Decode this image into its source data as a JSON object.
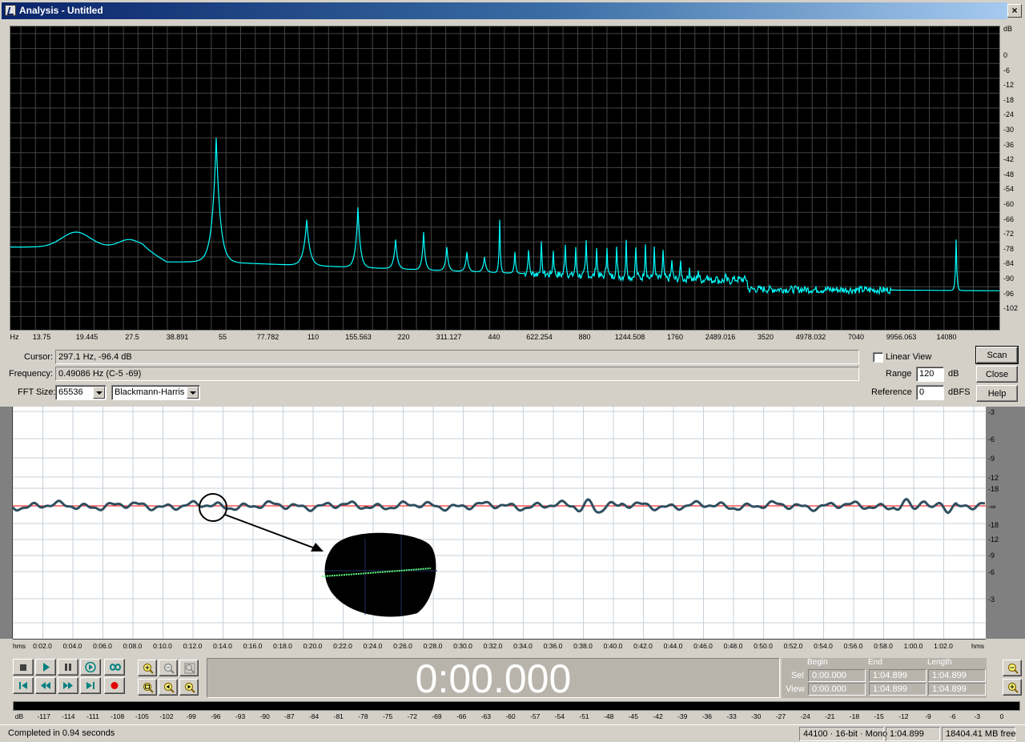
{
  "window": {
    "title": "Analysis - Untitled",
    "close_label": "×"
  },
  "spectrum": {
    "db_unit": "dB",
    "db_labels": [
      "0",
      "-6",
      "-12",
      "-18",
      "-24",
      "-30",
      "-36",
      "-42",
      "-48",
      "-54",
      "-60",
      "-66",
      "-72",
      "-78",
      "-84",
      "-90",
      "-96",
      "-102"
    ],
    "hz_unit": "Hz",
    "hz_labels": [
      "13.75",
      "19.445",
      "27.5",
      "38.891",
      "55",
      "77.782",
      "110",
      "155.563",
      "220",
      "311.127",
      "440",
      "622.254",
      "880",
      "1244.508",
      "1760",
      "2489.016",
      "3520",
      "4978.032",
      "7040",
      "9956.063",
      "14080"
    ],
    "trace_color": "#00ffff",
    "grid_color": "#444444"
  },
  "controls": {
    "cursor_label": "Cursor:",
    "cursor_value": "297.1 Hz,  -96.4 dB",
    "frequency_label": "Frequency:",
    "frequency_value": "0.49086 Hz (C-5 -69)",
    "fft_size_label": "FFT Size:",
    "fft_size_value": "65536",
    "window_value": "Blackmann-Harris",
    "linear_view_label": "Linear View",
    "range_label": "Range",
    "range_value": "120",
    "range_unit": "dB",
    "reference_label": "Reference",
    "reference_value": "0",
    "reference_unit": "dBFS",
    "scan_label": "Scan",
    "close_label": "Close",
    "help_label": "Help"
  },
  "waveform": {
    "scale_labels": [
      "-3",
      "-6",
      "-9",
      "-12",
      "-18",
      "-∞",
      "-18",
      "-12",
      "-9",
      "-6",
      "-3"
    ],
    "wave_color": "#2f4f5f",
    "center_line_color": "#ff0000",
    "time_labels": [
      "hms",
      "0:02.0",
      "0:04.0",
      "0:06.0",
      "0:08.0",
      "0:10.0",
      "0:12.0",
      "0:14.0",
      "0:16.0",
      "0:18.0",
      "0:20.0",
      "0:22.0",
      "0:24.0",
      "0:26.0",
      "0:28.0",
      "0:30.0",
      "0:32.0",
      "0:34.0",
      "0:36.0",
      "0:38.0",
      "0:40.0",
      "0:42.0",
      "0:44.0",
      "0:46.0",
      "0:48.0",
      "0:50.0",
      "0:52.0",
      "0:54.0",
      "0:56.0",
      "0:58.0",
      "1:00.0",
      "1:02.0",
      "hms"
    ]
  },
  "transport": {
    "time_display": "0:00.000",
    "begin_header": "Begin",
    "end_header": "End",
    "length_header": "Length",
    "sel_label": "Sel",
    "view_label": "View",
    "sel_begin": "0:00.000",
    "sel_end": "1:04.899",
    "sel_length": "1:04.899",
    "view_begin": "0:00.000",
    "view_end": "1:04.899",
    "view_length": "1:04.899"
  },
  "meter": {
    "labels": [
      "dB",
      "-117",
      "-114",
      "-111",
      "-108",
      "-105",
      "-102",
      "-99",
      "-96",
      "-93",
      "-90",
      "-87",
      "-84",
      "-81",
      "-78",
      "-75",
      "-72",
      "-69",
      "-66",
      "-63",
      "-60",
      "-57",
      "-54",
      "-51",
      "-48",
      "-45",
      "-42",
      "-39",
      "-36",
      "-33",
      "-30",
      "-27",
      "-24",
      "-21",
      "-18",
      "-15",
      "-12",
      "-9",
      "-6",
      "-3",
      "0"
    ]
  },
  "status": {
    "message": "Completed in 0.94 seconds",
    "format": "44100 · 16-bit · Mono",
    "length": "1:04.899",
    "free_space": "18404.41 MB free"
  }
}
